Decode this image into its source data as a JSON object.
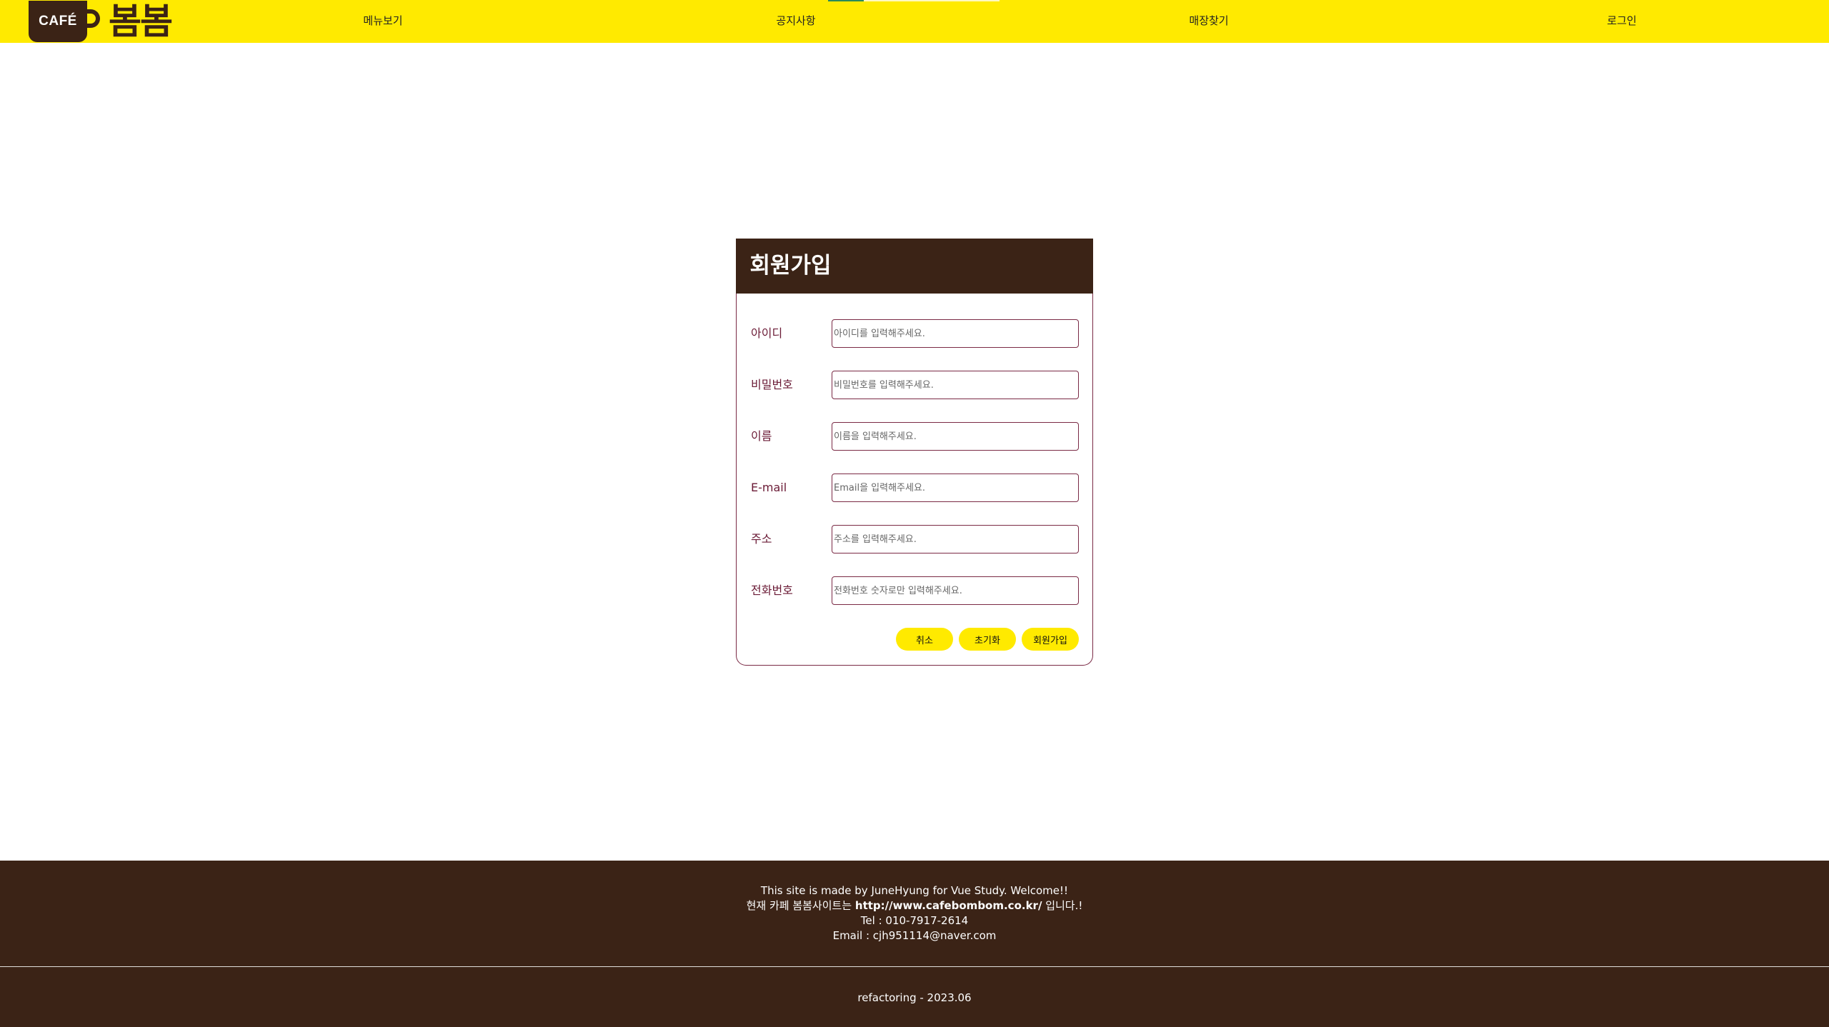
{
  "brand": {
    "cup_text": "CAFÉ",
    "word": "봄봄"
  },
  "nav": {
    "items": [
      "메뉴보기",
      "공지사항",
      "매장찾기",
      "로그인"
    ]
  },
  "form": {
    "title": "회원가입",
    "fields": [
      {
        "label": "아이디",
        "placeholder": "아이디를 입력해주세요."
      },
      {
        "label": "비밀번호",
        "placeholder": "비밀번호를 입력해주세요."
      },
      {
        "label": "이름",
        "placeholder": "이름을 입력해주세요."
      },
      {
        "label": "E-mail",
        "placeholder": "Email을 입력해주세요."
      },
      {
        "label": "주소",
        "placeholder": "주소를 입력해주세요."
      },
      {
        "label": "전화번호",
        "placeholder": "전화번호 숫자로만 입력해주세요."
      }
    ],
    "buttons": {
      "cancel": "취소",
      "reset": "초기화",
      "signup": "회원가입"
    }
  },
  "footer": {
    "line1": "This site is made by JuneHyung for Vue Study. Welcome!!",
    "line2_prefix": "현재 카페 봄봄사이트는 ",
    "line2_link": "http://www.cafebombom.co.kr/",
    "line2_suffix": " 입니다.!",
    "tel": "Tel : 010-7917-2614",
    "email": "Email : cjh951114@naver.com",
    "copy": "refactoring - 2023.06"
  },
  "colors": {
    "header_bg": "#ffea00",
    "brown": "#3b2316",
    "label": "#6a1a35",
    "button_bg": "#ffea00"
  }
}
